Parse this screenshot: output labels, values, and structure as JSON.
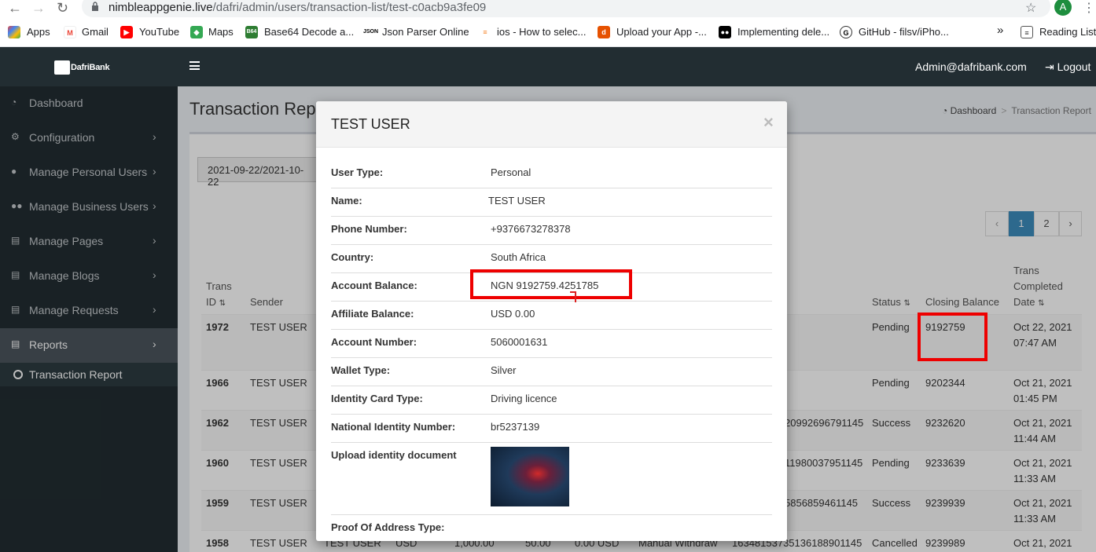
{
  "browser": {
    "url_host": "nimbleappgenie.live",
    "url_path": "/dafri/admin/users/transaction-list/test-c0acb9a3fe09",
    "profile_initial": "A",
    "bookmarks": [
      "Apps",
      "Gmail",
      "YouTube",
      "Maps",
      "Base64 Decode a...",
      "Json Parser Online",
      "ios - How to selec...",
      "Upload your App -...",
      "Implementing dele...",
      "GitHub - filsv/iPho..."
    ],
    "more": "»",
    "reading_list": "Reading List"
  },
  "header": {
    "logo_text": "DafriBank",
    "admin_email": "Admin@dafribank.com",
    "logout": "Logout"
  },
  "sidebar": {
    "items": [
      {
        "label": "Dashboard",
        "icon": "dashboard-icon"
      },
      {
        "label": "Configuration",
        "icon": "cogs-icon"
      },
      {
        "label": "Manage Personal Users",
        "icon": "user-icon"
      },
      {
        "label": "Manage Business Users",
        "icon": "users-icon"
      },
      {
        "label": "Manage Pages",
        "icon": "file-icon"
      },
      {
        "label": "Manage Blogs",
        "icon": "file-icon"
      },
      {
        "label": "Manage Requests",
        "icon": "file-icon"
      },
      {
        "label": "Reports",
        "icon": "file-icon"
      }
    ],
    "sub_item": "Transaction Report"
  },
  "page": {
    "title": "Transaction Rep",
    "breadcrumb_home": "Dashboard",
    "breadcrumb_sep": ">",
    "breadcrumb_current": "Transaction Report",
    "date_range": "2021-09-22/2021-10-22",
    "pagination": {
      "prev": "‹",
      "pages": [
        "1",
        "2"
      ],
      "next": "›",
      "active": "1"
    }
  },
  "table": {
    "headers": {
      "trans_id": "Trans ID",
      "sender": "Sender",
      "status": "Status",
      "closing_balance": "Closing Balance",
      "completed": "Trans Completed Date"
    },
    "rows": [
      {
        "id": "1972",
        "sender": "TEST USER",
        "ref": "",
        "status": "Pending",
        "closing": "9192759",
        "date": "Oct 22, 2021",
        "time": "07:47 AM"
      },
      {
        "id": "1966",
        "sender": "TEST USER",
        "ref": "",
        "status": "Pending",
        "closing": "9202344",
        "date": "Oct 21, 2021",
        "time": "01:45 PM"
      },
      {
        "id": "1962",
        "sender": "TEST USER",
        "ref": "20992696791145",
        "status": "Success",
        "closing": "9232620",
        "date": "Oct 21, 2021",
        "time": "11:44 AM"
      },
      {
        "id": "1960",
        "sender": "TEST USER",
        "ref": "11980037951145",
        "status": "Pending",
        "closing": "9233639",
        "date": "Oct 21, 2021",
        "time": "11:33 AM"
      },
      {
        "id": "1959",
        "sender": "TEST USER",
        "ref": "5856859461145",
        "status": "Success",
        "closing": "9239939",
        "date": "Oct 21, 2021",
        "time": "11:33 AM"
      },
      {
        "id": "1958",
        "sender": "TEST USER",
        "receiver": "TEST USER",
        "currency": "USD",
        "amount": "1,000.00",
        "fee": "50.00",
        "extra": "0.00 USD",
        "type": "Manual Withdraw",
        "ref": "16348153735136188901145",
        "status": "Cancelled",
        "closing": "9239989",
        "date": "Oct 21, 2021",
        "time": ""
      }
    ]
  },
  "modal": {
    "title": "TEST USER",
    "close": "×",
    "fields": [
      {
        "label": "User Type:",
        "value": "Personal"
      },
      {
        "label": "Name:",
        "value": "TEST USER"
      },
      {
        "label": "Phone Number:",
        "value": "+9376673278378"
      },
      {
        "label": "Country:",
        "value": "South Africa"
      },
      {
        "label": "Account Balance:",
        "value": "NGN 9192759.4251785"
      },
      {
        "label": "Affiliate Balance:",
        "value": "USD 0.00"
      },
      {
        "label": "Account Number:",
        "value": "5060001631"
      },
      {
        "label": "Wallet Type:",
        "value": "Silver"
      },
      {
        "label": "Identity Card Type:",
        "value": "Driving licence"
      },
      {
        "label": "National Identity Number:",
        "value": "br5237139"
      }
    ],
    "upload_label": "Upload identity document",
    "proof_label": "Proof Of Address Type:"
  },
  "colors": {
    "sidebar_bg": "#222d32",
    "highlight": "#e00000",
    "active_page": "#3c8dbc"
  }
}
